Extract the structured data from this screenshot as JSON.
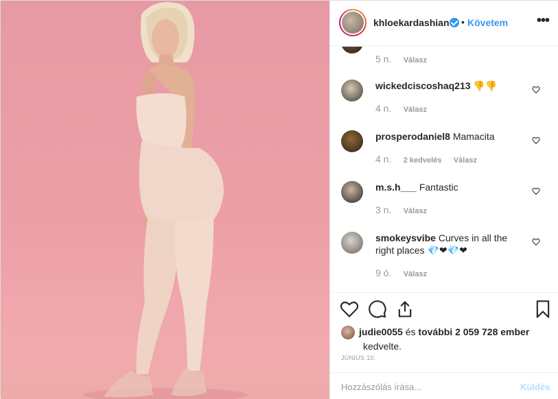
{
  "header": {
    "username": "khloekardashian",
    "separator": "•",
    "follow_label": "Követem",
    "more_label": "•••"
  },
  "comments": [
    {
      "username": "",
      "text": "",
      "time": "5 n.",
      "likes": "",
      "reply": "Válasz"
    },
    {
      "username": "wickedciscoshaq213",
      "text": "👎👎",
      "time": "4 n.",
      "likes": "",
      "reply": "Válasz"
    },
    {
      "username": "prosperodaniel8",
      "text": "Mamacita",
      "time": "4 n.",
      "likes": "2 kedvelés",
      "reply": "Válasz"
    },
    {
      "username": "m.s.h___",
      "text": "Fantastic",
      "time": "3 n.",
      "likes": "",
      "reply": "Válasz"
    },
    {
      "username": "smokeysvibe",
      "text": "Curves in all the right places 💎❤💎❤",
      "time": "9 ó.",
      "likes": "",
      "reply": "Válasz"
    }
  ],
  "likes": {
    "user": "judie0055",
    "connector": "és",
    "count_text": "további 2 059 728 ember",
    "suffix": "kedvelte."
  },
  "date": "JÚNIUS 10.",
  "comment_box": {
    "placeholder": "Hozzászólás írása...",
    "send_label": "Küldés"
  },
  "colors": {
    "accent": "#3897f0",
    "photo_background": "#ec9fa7",
    "send_disabled": "#b2dffc"
  },
  "icons": [
    "heart-icon",
    "comment-icon",
    "share-icon",
    "bookmark-icon",
    "verified-badge-icon",
    "more-options-icon"
  ]
}
